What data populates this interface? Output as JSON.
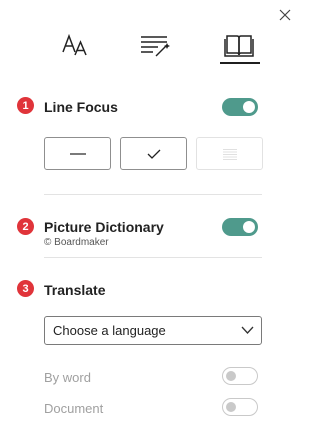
{
  "tabs": [
    {
      "icon": "text-size-icon",
      "selected": false
    },
    {
      "icon": "grammar-options-icon",
      "selected": false
    },
    {
      "icon": "reading-preferences-icon",
      "selected": true
    }
  ],
  "sections": {
    "line_focus": {
      "number": "1",
      "title": "Line Focus",
      "toggle_on": true,
      "options": [
        "one-line",
        "three-lines",
        "five-lines"
      ],
      "selected_option": "three-lines"
    },
    "picture_dictionary": {
      "number": "2",
      "title": "Picture Dictionary",
      "note": "© Boardmaker",
      "toggle_on": true
    },
    "translate": {
      "number": "3",
      "title": "Translate",
      "language_select": {
        "value": "Choose a language"
      },
      "by_word": {
        "label": "By word",
        "toggle_on": false
      },
      "document": {
        "label": "Document",
        "toggle_on": false
      }
    }
  },
  "colors": {
    "accent": "#4f9a8c",
    "badge": "#e0343a"
  }
}
